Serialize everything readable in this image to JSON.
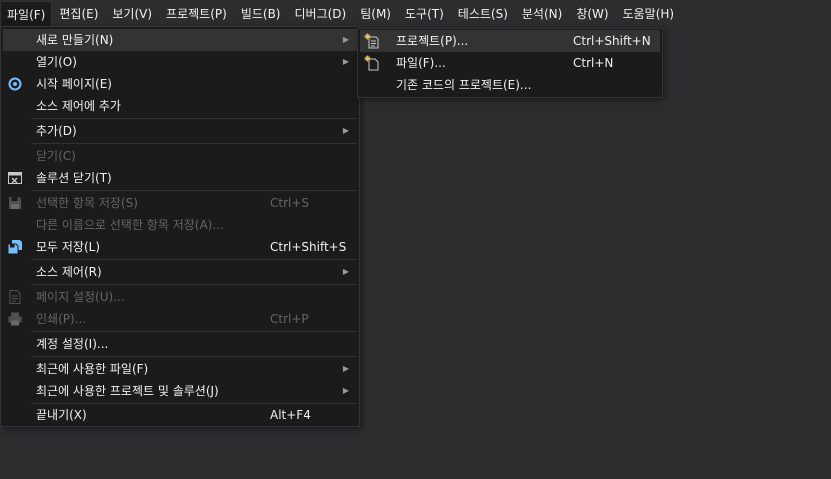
{
  "menubar": {
    "items": [
      {
        "label": "파일(F)"
      },
      {
        "label": "편집(E)"
      },
      {
        "label": "보기(V)"
      },
      {
        "label": "프로젝트(P)"
      },
      {
        "label": "빌드(B)"
      },
      {
        "label": "디버그(D)"
      },
      {
        "label": "팀(M)"
      },
      {
        "label": "도구(T)"
      },
      {
        "label": "테스트(S)"
      },
      {
        "label": "분석(N)"
      },
      {
        "label": "창(W)"
      },
      {
        "label": "도움말(H)"
      }
    ]
  },
  "file_menu": {
    "items": [
      {
        "label": "새로 만들기(N)",
        "has_submenu": true
      },
      {
        "label": "열기(O)",
        "has_submenu": true
      },
      {
        "label": "시작 페이지(E)",
        "icon": "start-page-icon"
      },
      {
        "label": "소스 제어에 추가"
      },
      {
        "label": "추가(D)",
        "has_submenu": true
      },
      {
        "label": "닫기(C)",
        "disabled": true
      },
      {
        "label": "솔루션 닫기(T)",
        "icon": "close-solution-icon"
      },
      {
        "label": "선택한 항목 저장(S)",
        "shortcut": "Ctrl+S",
        "disabled": true,
        "icon": "save-icon"
      },
      {
        "label": "다른 이름으로 선택한 항목 저장(A)...",
        "disabled": true
      },
      {
        "label": "모두 저장(L)",
        "shortcut": "Ctrl+Shift+S",
        "icon": "save-all-icon"
      },
      {
        "label": "소스 제어(R)",
        "has_submenu": true
      },
      {
        "label": "페이지 설정(U)...",
        "disabled": true,
        "icon": "page-setup-icon"
      },
      {
        "label": "인쇄(P)...",
        "shortcut": "Ctrl+P",
        "disabled": true,
        "icon": "print-icon"
      },
      {
        "label": "계정 설정(I)..."
      },
      {
        "label": "최근에 사용한 파일(F)",
        "has_submenu": true
      },
      {
        "label": "최근에 사용한 프로젝트 및 솔루션(J)",
        "has_submenu": true
      },
      {
        "label": "끝내기(X)",
        "shortcut": "Alt+F4"
      }
    ]
  },
  "new_submenu": {
    "items": [
      {
        "label": "프로젝트(P)...",
        "shortcut": "Ctrl+Shift+N",
        "icon": "new-project-icon"
      },
      {
        "label": "파일(F)...",
        "shortcut": "Ctrl+N",
        "icon": "new-file-icon"
      },
      {
        "label": "기존 코드의 프로젝트(E)..."
      }
    ]
  },
  "glyphs": {
    "submenu_arrow": "▶"
  },
  "colors": {
    "background": "#2d2d30",
    "menu_background": "#1b1b1c",
    "highlight": "#333334",
    "text": "#f1f1f1",
    "disabled_text": "#656565",
    "accent_blue": "#75beff"
  }
}
